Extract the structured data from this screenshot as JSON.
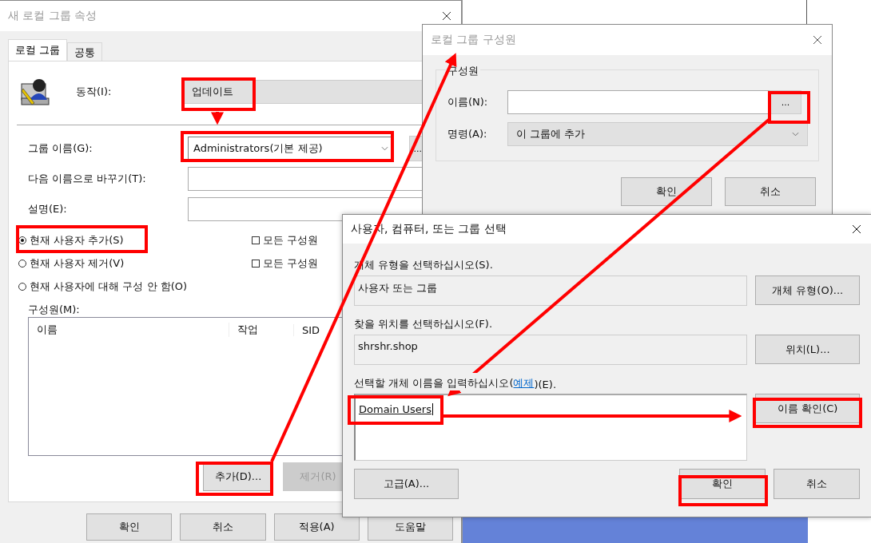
{
  "properties_dialog": {
    "title": "새 로컬 그룹 속성",
    "tabs": [
      {
        "label": "로컬 그룹",
        "selected": true
      },
      {
        "label": "공통",
        "selected": false
      }
    ],
    "action": {
      "label": "동작(I):",
      "value": "업데이트"
    },
    "fields": [
      {
        "label": "그룹 이름(G):",
        "kind": "dropdown",
        "value": "Administrators(기본 제공)",
        "browse": "..."
      },
      {
        "label": "다음 이름으로 바꾸기(T):",
        "kind": "text"
      },
      {
        "label": "설명(E):",
        "kind": "text"
      }
    ],
    "radios": [
      {
        "label": "현재 사용자 추가(S)",
        "selected": true
      },
      {
        "label": "현재 사용자 제거(V)",
        "selected": false
      },
      {
        "label": "현재 사용자에 대해 구성 안 함(O)",
        "selected": false
      }
    ],
    "checkboxes": [
      {
        "label": "모든 구성원",
        "checked": false
      },
      {
        "label": "모든 구성원",
        "checked": false
      }
    ],
    "members": {
      "label": "구성원(M):",
      "columns": [
        "이름",
        "작업",
        "SID"
      ]
    },
    "list_buttons": [
      {
        "label": "추가(D)...",
        "disabled": false
      },
      {
        "label": "제거(R)",
        "disabled": true
      }
    ],
    "buttons": [
      "확인",
      "취소",
      "적용(A)",
      "도움말"
    ]
  },
  "members_dialog": {
    "title": "로컬 그룹 구성원",
    "group": "구성원",
    "name_label": "이름(N):",
    "browse": "...",
    "command_label": "명령(A):",
    "command": "이 그룹에 추가",
    "buttons": [
      "확인",
      "취소"
    ]
  },
  "select_dialog": {
    "title": "사용자, 컴퓨터, 또는 그룹 선택",
    "object_type_label": "개체 유형을 선택하십시오(S).",
    "object_type": "사용자 또는 그룹",
    "object_type_button": "개체 유형(O)...",
    "location_label": "찾을 위치를 선택하십시오(F).",
    "location": "shrshr.shop",
    "location_button": "위치(L)...",
    "names_label_before": "선택할 개체 이름을 입력하십시오(",
    "names_link": "예제",
    "names_label_after": ")(E).",
    "names_value": "Domain Users",
    "check_button": "이름 확인(C)",
    "advanced_button": "고급(A)...",
    "buttons": [
      "확인",
      "취소"
    ]
  }
}
